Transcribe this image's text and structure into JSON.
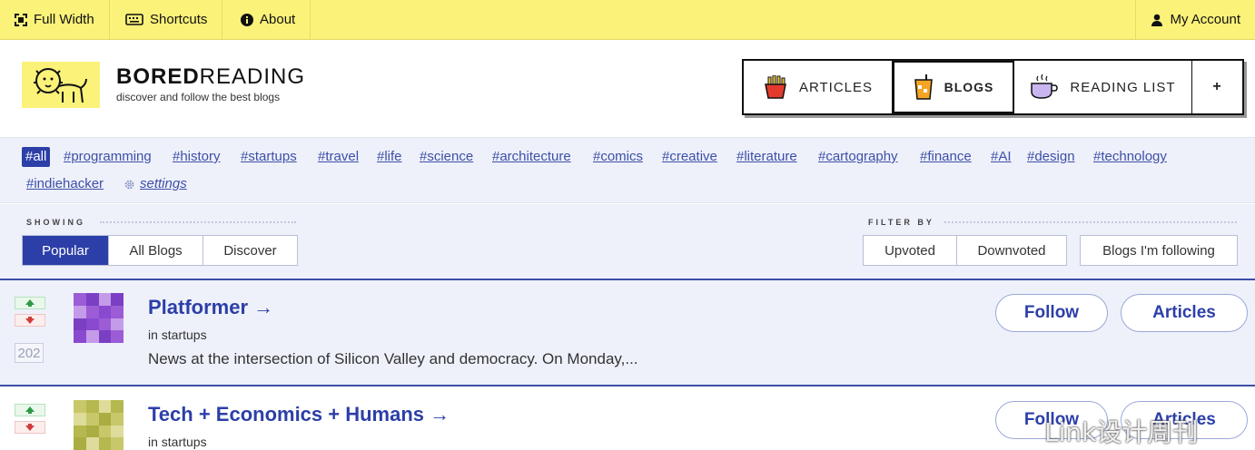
{
  "topbar": {
    "full_width": "Full Width",
    "shortcuts": "Shortcuts",
    "about": "About",
    "my_account": "My Account"
  },
  "brand": {
    "title_bold": "BORED",
    "title_light": "READING",
    "tagline": "discover and follow the best blogs",
    "logo_icon": "lion-icon",
    "logo_bg": "#fbf27a"
  },
  "nav": {
    "articles": "ARTICLES",
    "blogs": "BLOGS",
    "reading_list": "READING LIST",
    "plus": "+",
    "active": "BLOGS"
  },
  "tags": [
    "#all",
    "#programming",
    "#history",
    "#startups",
    "#travel",
    "#life",
    "#science",
    "#architecture",
    "#comics",
    "#creative",
    "#literature",
    "#cartography",
    "#finance",
    "#AI",
    "#design",
    "#technology",
    "#indiehacker"
  ],
  "tag_settings": "settings",
  "showing": {
    "label": "SHOWING",
    "options": [
      "Popular",
      "All Blogs",
      "Discover"
    ],
    "active": "Popular"
  },
  "filter_by": {
    "label": "FILTER BY",
    "options": [
      "Upvoted",
      "Downvoted"
    ],
    "following": "Blogs I'm following"
  },
  "blogs": [
    {
      "title": "Platformer →",
      "category": "in startups",
      "description": "News at the intersection of Silicon Valley and democracy. On Monday,...",
      "votes": "202",
      "follow": "Follow",
      "articles": "Articles",
      "avatar_colors": [
        "#9b5cd6",
        "#7b3fc4",
        "#c49be8",
        "#8a4ad0"
      ]
    },
    {
      "title": "Tech + Economics + Humans →",
      "category": "in startups",
      "description": "",
      "votes": "",
      "follow": "Follow",
      "articles": "Articles",
      "avatar_colors": [
        "#c8c86a",
        "#b5b84e",
        "#dedc9a",
        "#a9ad42"
      ]
    }
  ],
  "watermark": "Link设计周刊",
  "colors": {
    "accent": "#2c3fa8",
    "topbar": "#fbf27a",
    "panel": "#eef1fa"
  }
}
